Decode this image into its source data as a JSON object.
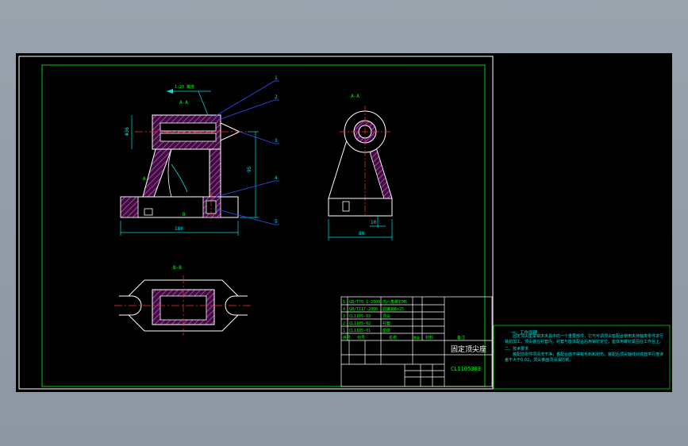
{
  "drawing": {
    "title": "固定顶尖座",
    "drawing_number": "CL1105303",
    "section_aa_label": "A-A",
    "section_bb_label": "B-B",
    "label_a_side": "A",
    "label_b_side": "B",
    "dim_width": "180",
    "dim_height": "95",
    "dim_side_width": "80",
    "dim_side_small": "10",
    "dim_left": "Φ36",
    "taper_note": "1:20 锥度",
    "balloons": [
      "1",
      "2",
      "3",
      "4",
      "5"
    ]
  },
  "bom": {
    "rows": [
      {
        "no": "5",
        "code": "GB/T70.1-2000",
        "name": "内六角螺钉M6"
      },
      {
        "no": "4",
        "code": "GB/T117-2000",
        "name": "圆锥销6×25"
      },
      {
        "no": "3",
        "code": "CL1105-03",
        "name": "顶尖"
      },
      {
        "no": "2",
        "code": "CL1105-02",
        "name": "衬套"
      },
      {
        "no": "1",
        "code": "CL1105-01",
        "name": "座体"
      }
    ],
    "header": {
      "no": "序号",
      "code": "代号",
      "name": "名称",
      "qty": "数量",
      "material": "材料",
      "note": "备注"
    }
  },
  "notes": {
    "heading1": "一、工作原理",
    "body1": "固定顶尖座是铣床夹具中的一个重要部件，它与可调顶尖座配合使用夹持轴类零件进行铣削加工。顶尖装在衬套内，衬套与座体配合后用销钉定位，座体用螺钉紧固在工作台上。",
    "heading2": "二、技术要求",
    "body2": "装配前零件须清洗干净，各配合面不得有毛刺和划伤。装配后顶尖轴线对底面平行度误差不大于0.02，顶尖锥面须涂油防锈。"
  },
  "colors": {
    "frame": "#00d000",
    "outline": "#ffffff",
    "hatch": "#d040d0",
    "dimension": "#00e0e0",
    "leader": "#2f4fff",
    "center": "#ff3030",
    "text": "#00ff00"
  }
}
